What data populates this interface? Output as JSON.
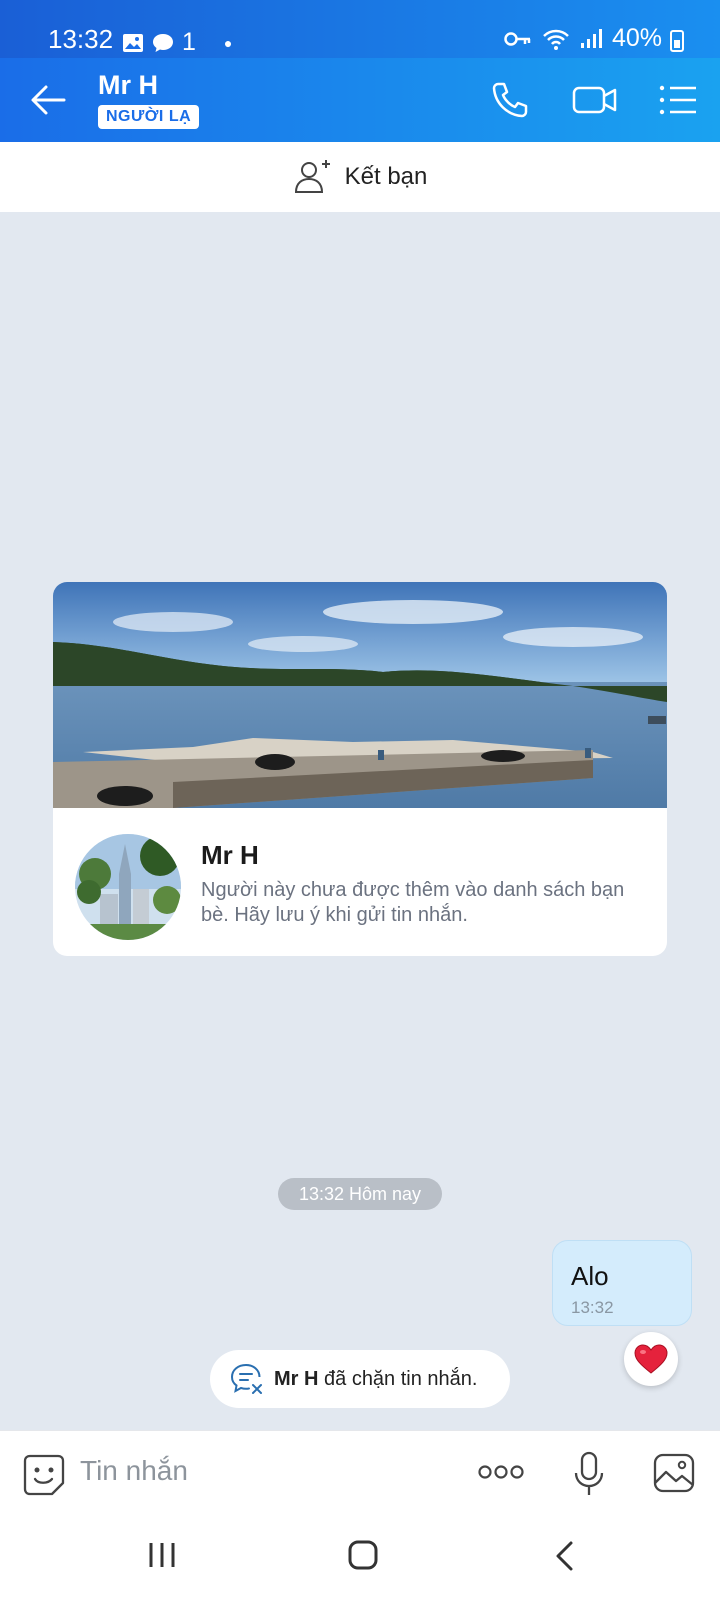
{
  "status_bar": {
    "time": "13:32",
    "notif_number": "1",
    "battery": "40%"
  },
  "header": {
    "contact_name": "Mr H",
    "stranger_badge": "NGƯỜI LẠ"
  },
  "add_friend": {
    "label": "Kết bạn"
  },
  "profile_card": {
    "name": "Mr H",
    "description": "Người này chưa được thêm vào danh sách bạn bè. Hãy lưu ý khi gửi tin nhắn."
  },
  "chat": {
    "time_separator": "13:32 Hôm nay",
    "messages": [
      {
        "text": "Alo",
        "time": "13:32",
        "outgoing": true
      }
    ],
    "blocked_notice_name": "Mr H",
    "blocked_notice_rest": " đã chặn tin nhắn."
  },
  "input": {
    "placeholder": "Tin nhắn"
  },
  "icons": {
    "back": "arrow-left-icon",
    "call": "phone-icon",
    "video": "video-camera-icon",
    "menu": "list-menu-icon",
    "add_friend": "add-person-icon",
    "sticker": "sticker-icon",
    "more": "more-dots-icon",
    "mic": "microphone-icon",
    "image": "image-icon",
    "heart": "heart-icon"
  },
  "colors": {
    "header_start": "#1a6de8",
    "header_end": "#1aa2f0",
    "chat_bg": "#e2e8f0",
    "bubble_outgoing": "#d4ecfc"
  }
}
